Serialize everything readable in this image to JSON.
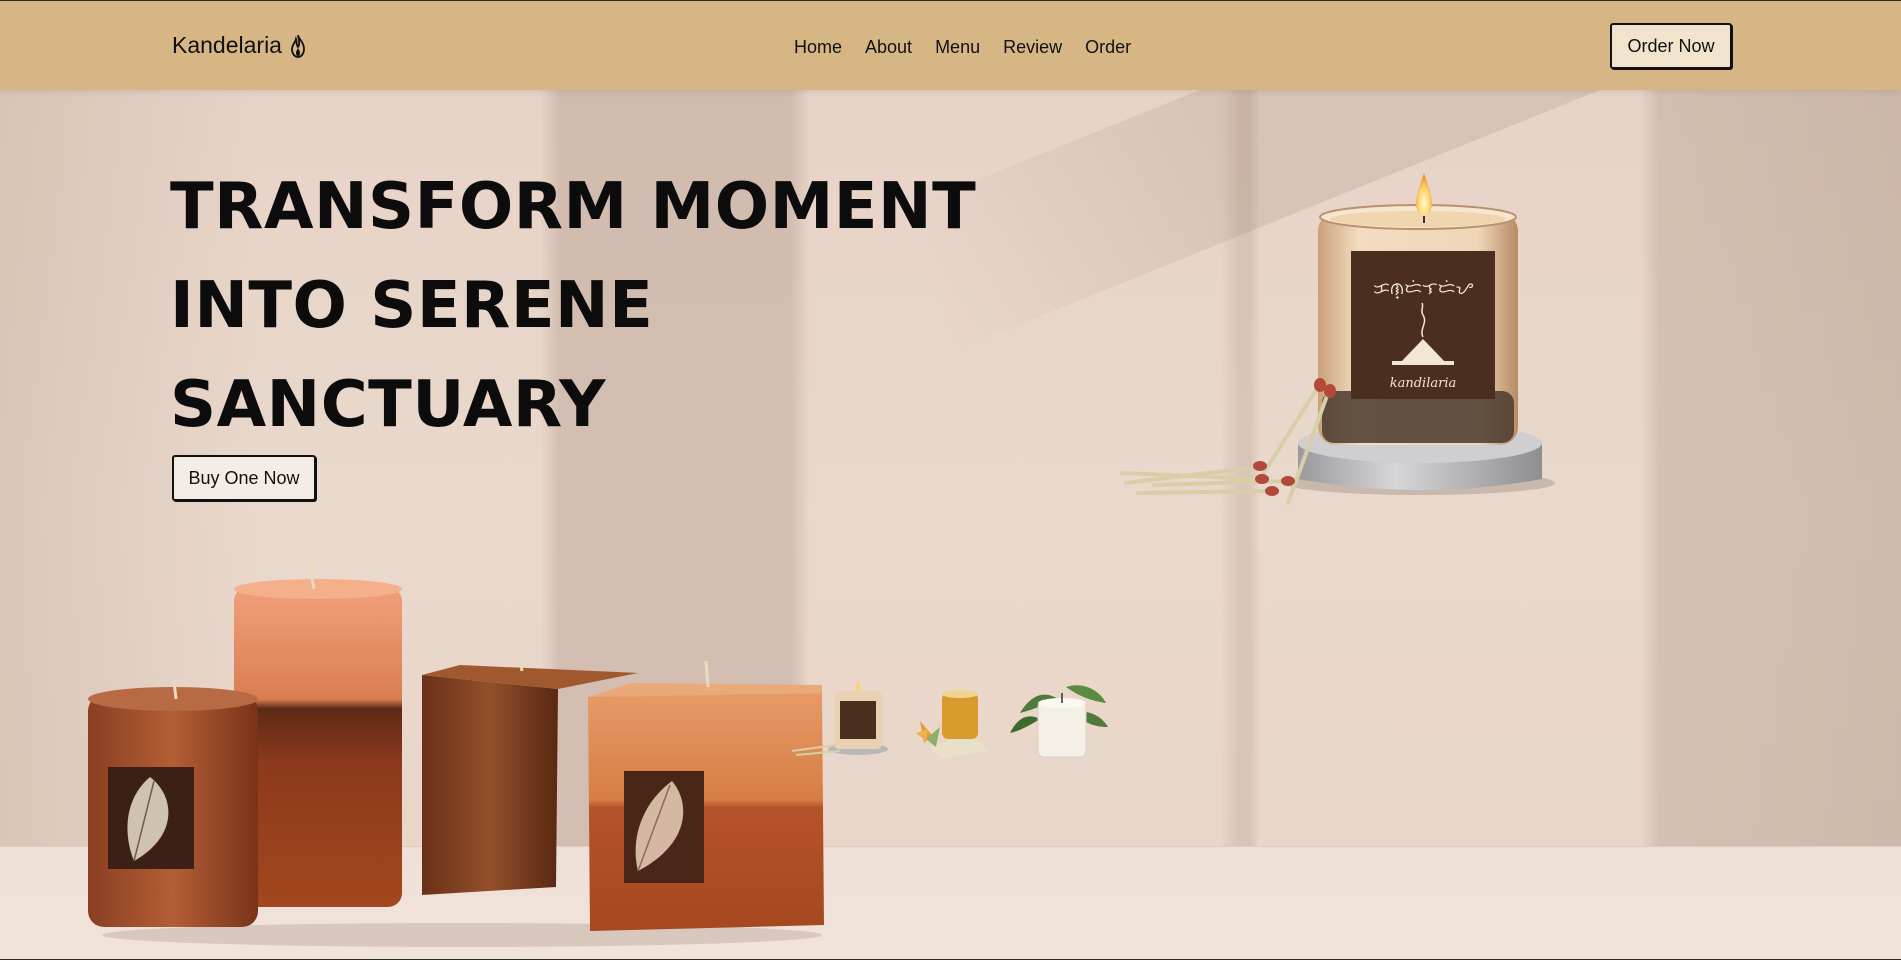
{
  "brand": {
    "name": "Kandelaria",
    "logo_icon": "flame-icon"
  },
  "nav": {
    "items": [
      {
        "label": "Home"
      },
      {
        "label": "About"
      },
      {
        "label": "Menu"
      },
      {
        "label": "Review"
      },
      {
        "label": "Order"
      }
    ],
    "cta_label": "Order Now"
  },
  "hero": {
    "title_lines": [
      "TRANSFORM MOMENT",
      "INTO SERENE",
      "SANCTUARY"
    ],
    "cta_label": "Buy One Now",
    "product_label_text": "kandilaria"
  },
  "thumbnails": [
    {
      "name": "jar-candle-thumbnail"
    },
    {
      "name": "amber-candle-thumbnail"
    },
    {
      "name": "white-candle-thumbnail"
    }
  ],
  "colors": {
    "header_bg": "#d7b686",
    "page_bg": "#ecd9cd",
    "text": "#0c0c0c",
    "button_bg": "#f1e3cc"
  }
}
